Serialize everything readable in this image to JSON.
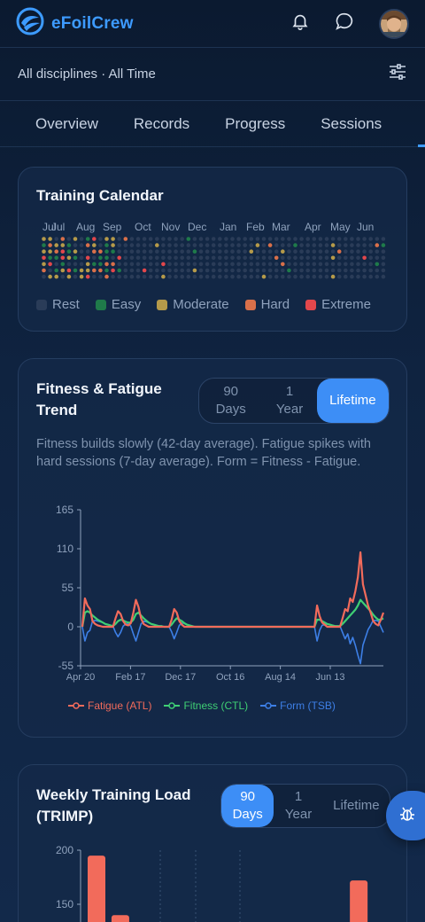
{
  "app": {
    "name": "eFoilCrew"
  },
  "header": {
    "icons": [
      "logo-icon",
      "bell-icon",
      "chat-icon",
      "avatar"
    ]
  },
  "filter": {
    "label": "All disciplines · All Time"
  },
  "tabs": [
    {
      "label": "Overview"
    },
    {
      "label": "Records"
    },
    {
      "label": "Progress"
    },
    {
      "label": "Sessions"
    }
  ],
  "calendar": {
    "title": "Training Calendar",
    "months": [
      "Jul",
      "Jul",
      "Aug",
      "Sep",
      "Oct",
      "Nov",
      "Dec",
      "Jan",
      "Feb",
      "Mar",
      "Apr",
      "May",
      "Jun"
    ],
    "legend": [
      {
        "label": "Rest",
        "color": "#2a3c58"
      },
      {
        "label": "Easy",
        "color": "#1f7a4a"
      },
      {
        "label": "Moderate",
        "color": "#b59a4a"
      },
      {
        "label": "Hard",
        "color": "#d9704a"
      },
      {
        "label": "Extreme",
        "color": "#e2474c"
      }
    ]
  },
  "fitness": {
    "title_line1": "Fitness & Fatigue",
    "title_line2": "Trend",
    "ranges": [
      {
        "line1": "90",
        "line2": "Days"
      },
      {
        "line1": "1",
        "line2": "Year"
      },
      {
        "line1": "Lifetime",
        "line2": ""
      }
    ],
    "active_range": "Lifetime",
    "description": "Fitness builds slowly (42-day average). Fatigue spikes with hard sessions (7-day average). Form = Fitness - Fatigue."
  },
  "weekly": {
    "title_line1": "Weekly Training Load",
    "title_line2": "(TRIMP)",
    "ranges": [
      {
        "line1": "90",
        "line2": "Days"
      },
      {
        "line1": "1",
        "line2": "Year"
      },
      {
        "line1": "Lifetime",
        "line2": ""
      }
    ],
    "active_range": "90 Days"
  },
  "chart_data": [
    {
      "type": "line",
      "x_tick_labels": [
        "Apr 20",
        "Feb 17",
        "Dec 17",
        "Oct 16",
        "Aug 14",
        "Jun 13"
      ],
      "y_ticks": [
        165,
        110,
        55,
        0,
        -55
      ],
      "ylim": [
        -55,
        165
      ],
      "grid": false,
      "legend_position": "bottom",
      "series": [
        {
          "name": "Fatigue (ATL)",
          "color": "#f26b5b",
          "values": [
            0,
            40,
            30,
            25,
            8,
            4,
            2,
            1,
            0,
            0,
            0,
            0,
            0,
            12,
            22,
            18,
            8,
            3,
            2,
            5,
            20,
            38,
            28,
            12,
            4,
            2,
            0,
            0,
            0,
            0,
            0,
            0,
            0,
            0,
            0,
            10,
            25,
            20,
            8,
            3,
            0,
            0,
            0,
            0,
            0,
            0,
            0,
            0,
            0,
            0,
            0,
            0,
            0,
            0,
            0,
            0,
            0,
            0,
            0,
            0,
            0,
            0,
            0,
            0,
            0,
            0,
            0,
            0,
            0,
            0,
            0,
            0,
            0,
            0,
            0,
            0,
            0,
            0,
            0,
            0,
            0,
            0,
            0,
            0,
            0,
            0,
            0,
            0,
            0,
            0,
            0,
            0,
            30,
            15,
            6,
            3,
            0,
            0,
            0,
            0,
            0,
            0,
            12,
            25,
            22,
            40,
            35,
            50,
            70,
            105,
            60,
            45,
            30,
            20,
            8,
            4,
            2,
            10,
            20
          ]
        },
        {
          "name": "Fitness (CTL)",
          "color": "#3fcf74",
          "values": [
            0,
            20,
            22,
            20,
            16,
            13,
            10,
            8,
            6,
            4,
            3,
            2,
            1,
            4,
            8,
            10,
            9,
            7,
            6,
            6,
            10,
            18,
            20,
            16,
            12,
            9,
            6,
            4,
            3,
            2,
            1,
            1,
            0,
            0,
            0,
            3,
            8,
            12,
            10,
            8,
            5,
            3,
            2,
            1,
            0,
            0,
            0,
            0,
            0,
            0,
            0,
            0,
            0,
            0,
            0,
            0,
            0,
            0,
            0,
            0,
            0,
            0,
            0,
            0,
            0,
            0,
            0,
            0,
            0,
            0,
            0,
            0,
            0,
            0,
            0,
            0,
            0,
            0,
            0,
            0,
            0,
            0,
            0,
            0,
            0,
            0,
            0,
            0,
            0,
            0,
            0,
            0,
            10,
            10,
            8,
            6,
            4,
            3,
            2,
            1,
            1,
            1,
            4,
            8,
            12,
            16,
            20,
            24,
            30,
            38,
            34,
            30,
            26,
            22,
            17,
            13,
            10,
            10,
            12
          ]
        },
        {
          "name": "Form (TSB)",
          "color": "#3d7fe6",
          "values": [
            0,
            -20,
            -8,
            -5,
            8,
            9,
            8,
            7,
            6,
            4,
            3,
            2,
            1,
            -8,
            -14,
            -8,
            1,
            4,
            4,
            1,
            -10,
            -20,
            -8,
            4,
            8,
            7,
            6,
            4,
            3,
            2,
            1,
            1,
            0,
            0,
            0,
            -7,
            -17,
            -8,
            2,
            5,
            5,
            3,
            2,
            1,
            0,
            0,
            0,
            0,
            0,
            0,
            0,
            0,
            0,
            0,
            0,
            0,
            0,
            0,
            0,
            0,
            0,
            0,
            0,
            0,
            0,
            0,
            0,
            0,
            0,
            0,
            0,
            0,
            0,
            0,
            0,
            0,
            0,
            0,
            0,
            0,
            0,
            0,
            0,
            0,
            0,
            0,
            0,
            0,
            0,
            0,
            0,
            0,
            -20,
            -5,
            2,
            3,
            4,
            3,
            2,
            1,
            1,
            1,
            -8,
            -17,
            -10,
            -24,
            -15,
            -26,
            -40,
            -52,
            -26,
            -15,
            -4,
            2,
            9,
            9,
            8,
            0,
            -8
          ]
        }
      ]
    },
    {
      "type": "bar",
      "y_ticks": [
        200,
        150
      ],
      "ylim": [
        0,
        200
      ],
      "values": [
        195,
        140,
        0,
        0,
        0,
        0,
        0,
        0,
        0,
        0,
        0,
        172,
        0
      ]
    }
  ]
}
